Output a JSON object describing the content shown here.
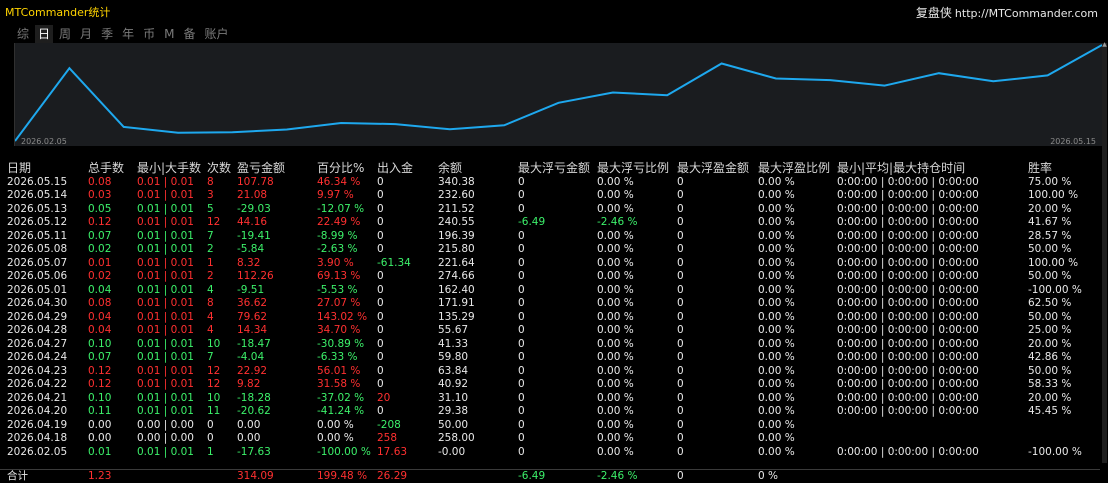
{
  "title": "MTCommander统计",
  "brand": {
    "name": "复盘侠",
    "url": "http://MTCommander.com"
  },
  "tabs": [
    {
      "label": "综",
      "active": false
    },
    {
      "label": "日",
      "active": true
    },
    {
      "label": "周",
      "active": false
    },
    {
      "label": "月",
      "active": false
    },
    {
      "label": "季",
      "active": false
    },
    {
      "label": "年",
      "active": false
    },
    {
      "label": "币",
      "active": false
    },
    {
      "label": "M",
      "active": false
    },
    {
      "label": "备",
      "active": false
    },
    {
      "label": "账户",
      "active": false
    }
  ],
  "colors": {
    "line": "#1ea8ee",
    "loss": "#ff3030",
    "profit": "#3cf06a",
    "chart_bg": "#1a1c1f"
  },
  "chart_data": {
    "type": "line",
    "x_labels": [
      "2026.02.05",
      "2026.05.15"
    ],
    "x": [
      "2026.02.05",
      "2026.04.18",
      "2026.04.19",
      "2026.04.20",
      "2026.04.21",
      "2026.04.22",
      "2026.04.23",
      "2026.04.24",
      "2026.04.27",
      "2026.04.28",
      "2026.04.29",
      "2026.04.30",
      "2026.05.01",
      "2026.05.06",
      "2026.05.07",
      "2026.05.08",
      "2026.05.11",
      "2026.05.12",
      "2026.05.13",
      "2026.05.14",
      "2026.05.15"
    ],
    "y": [
      -0.0,
      258.0,
      50.0,
      29.38,
      31.1,
      40.92,
      63.84,
      59.8,
      41.33,
      55.67,
      135.29,
      171.91,
      162.4,
      274.66,
      221.64,
      215.8,
      196.39,
      240.55,
      211.52,
      232.6,
      340.38
    ],
    "ylim": [
      0,
      340.38
    ],
    "grid": false
  },
  "table": {
    "headers": [
      "日期",
      "总手数",
      "最小|大手数",
      "次数",
      "盈亏金额",
      "百分比%",
      "出入金",
      "余额",
      "最大浮亏金额",
      "最大浮亏比例",
      "最大浮盈金额",
      "最大浮盈比例",
      "最小|平均|最大持仓时间",
      "胜率"
    ],
    "rows": [
      {
        "cells": [
          "2026.05.15",
          "0.08",
          "0.01 | 0.01",
          "8",
          "107.78",
          "46.34 %",
          "0",
          "340.38",
          "0",
          "0.00 %",
          "0",
          "0.00 %",
          "0:00:00 | 0:00:00 | 0:00:00",
          "75.00 %"
        ],
        "pl": "loss",
        "io": "wh",
        "mfe": "wh"
      },
      {
        "cells": [
          "2026.05.14",
          "0.03",
          "0.01 | 0.01",
          "3",
          "21.08",
          "9.97 %",
          "0",
          "232.60",
          "0",
          "0.00 %",
          "0",
          "0.00 %",
          "0:00:00 | 0:00:00 | 0:00:00",
          "100.00 %"
        ],
        "pl": "loss",
        "io": "wh",
        "mfe": "wh"
      },
      {
        "cells": [
          "2026.05.13",
          "0.05",
          "0.01 | 0.01",
          "5",
          "-29.03",
          "-12.07 %",
          "0",
          "211.52",
          "0",
          "0.00 %",
          "0",
          "0.00 %",
          "0:00:00 | 0:00:00 | 0:00:00",
          "20.00 %"
        ],
        "pl": "profit",
        "io": "wh",
        "mfe": "wh"
      },
      {
        "cells": [
          "2026.05.12",
          "0.12",
          "0.01 | 0.01",
          "12",
          "44.16",
          "22.49 %",
          "0",
          "240.55",
          "-6.49",
          "-2.46 %",
          "0",
          "0.00 %",
          "0:00:00 | 0:00:00 | 0:00:00",
          "41.67 %"
        ],
        "pl": "loss",
        "io": "wh",
        "mfe": "profit"
      },
      {
        "cells": [
          "2026.05.11",
          "0.07",
          "0.01 | 0.01",
          "7",
          "-19.41",
          "-8.99 %",
          "0",
          "196.39",
          "0",
          "0.00 %",
          "0",
          "0.00 %",
          "0:00:00 | 0:00:00 | 0:00:00",
          "28.57 %"
        ],
        "pl": "profit",
        "io": "wh",
        "mfe": "wh"
      },
      {
        "cells": [
          "2026.05.08",
          "0.02",
          "0.01 | 0.01",
          "2",
          "-5.84",
          "-2.63 %",
          "0",
          "215.80",
          "0",
          "0.00 %",
          "0",
          "0.00 %",
          "0:00:00 | 0:00:00 | 0:00:00",
          "50.00 %"
        ],
        "pl": "profit",
        "io": "wh",
        "mfe": "wh"
      },
      {
        "cells": [
          "2026.05.07",
          "0.01",
          "0.01 | 0.01",
          "1",
          "8.32",
          "3.90 %",
          "-61.34",
          "221.64",
          "0",
          "0.00 %",
          "0",
          "0.00 %",
          "0:00:00 | 0:00:00 | 0:00:00",
          "100.00 %"
        ],
        "pl": "loss",
        "io": "profit",
        "mfe": "wh"
      },
      {
        "cells": [
          "2026.05.06",
          "0.02",
          "0.01 | 0.01",
          "2",
          "112.26",
          "69.13 %",
          "0",
          "274.66",
          "0",
          "0.00 %",
          "0",
          "0.00 %",
          "0:00:00 | 0:00:00 | 0:00:00",
          "50.00 %"
        ],
        "pl": "loss",
        "io": "wh",
        "mfe": "wh"
      },
      {
        "cells": [
          "2026.05.01",
          "0.04",
          "0.01 | 0.01",
          "4",
          "-9.51",
          "-5.53 %",
          "0",
          "162.40",
          "0",
          "0.00 %",
          "0",
          "0.00 %",
          "0:00:00 | 0:00:00 | 0:00:00",
          "-100.00 %"
        ],
        "pl": "profit",
        "io": "wh",
        "mfe": "wh"
      },
      {
        "cells": [
          "2026.04.30",
          "0.08",
          "0.01 | 0.01",
          "8",
          "36.62",
          "27.07 %",
          "0",
          "171.91",
          "0",
          "0.00 %",
          "0",
          "0.00 %",
          "0:00:00 | 0:00:00 | 0:00:00",
          "62.50 %"
        ],
        "pl": "loss",
        "io": "wh",
        "mfe": "wh"
      },
      {
        "cells": [
          "2026.04.29",
          "0.04",
          "0.01 | 0.01",
          "4",
          "79.62",
          "143.02 %",
          "0",
          "135.29",
          "0",
          "0.00 %",
          "0",
          "0.00 %",
          "0:00:00 | 0:00:00 | 0:00:00",
          "50.00 %"
        ],
        "pl": "loss",
        "io": "wh",
        "mfe": "wh"
      },
      {
        "cells": [
          "2026.04.28",
          "0.04",
          "0.01 | 0.01",
          "4",
          "14.34",
          "34.70 %",
          "0",
          "55.67",
          "0",
          "0.00 %",
          "0",
          "0.00 %",
          "0:00:00 | 0:00:00 | 0:00:00",
          "25.00 %"
        ],
        "pl": "loss",
        "io": "wh",
        "mfe": "wh"
      },
      {
        "cells": [
          "2026.04.27",
          "0.10",
          "0.01 | 0.01",
          "10",
          "-18.47",
          "-30.89 %",
          "0",
          "41.33",
          "0",
          "0.00 %",
          "0",
          "0.00 %",
          "0:00:00 | 0:00:00 | 0:00:00",
          "20.00 %"
        ],
        "pl": "profit",
        "io": "wh",
        "mfe": "wh"
      },
      {
        "cells": [
          "2026.04.24",
          "0.07",
          "0.01 | 0.01",
          "7",
          "-4.04",
          "-6.33 %",
          "0",
          "59.80",
          "0",
          "0.00 %",
          "0",
          "0.00 %",
          "0:00:00 | 0:00:00 | 0:00:00",
          "42.86 %"
        ],
        "pl": "profit",
        "io": "wh",
        "mfe": "wh"
      },
      {
        "cells": [
          "2026.04.23",
          "0.12",
          "0.01 | 0.01",
          "12",
          "22.92",
          "56.01 %",
          "0",
          "63.84",
          "0",
          "0.00 %",
          "0",
          "0.00 %",
          "0:00:00 | 0:00:00 | 0:00:00",
          "50.00 %"
        ],
        "pl": "loss",
        "io": "wh",
        "mfe": "wh"
      },
      {
        "cells": [
          "2026.04.22",
          "0.12",
          "0.01 | 0.01",
          "12",
          "9.82",
          "31.58 %",
          "0",
          "40.92",
          "0",
          "0.00 %",
          "0",
          "0.00 %",
          "0:00:00 | 0:00:00 | 0:00:00",
          "58.33 %"
        ],
        "pl": "loss",
        "io": "wh",
        "mfe": "wh"
      },
      {
        "cells": [
          "2026.04.21",
          "0.10",
          "0.01 | 0.01",
          "10",
          "-18.28",
          "-37.02 %",
          "20",
          "31.10",
          "0",
          "0.00 %",
          "0",
          "0.00 %",
          "0:00:00 | 0:00:00 | 0:00:00",
          "20.00 %"
        ],
        "pl": "profit",
        "io": "loss",
        "mfe": "wh"
      },
      {
        "cells": [
          "2026.04.20",
          "0.11",
          "0.01 | 0.01",
          "11",
          "-20.62",
          "-41.24 %",
          "0",
          "29.38",
          "0",
          "0.00 %",
          "0",
          "0.00 %",
          "0:00:00 | 0:00:00 | 0:00:00",
          "45.45 %"
        ],
        "pl": "profit",
        "io": "wh",
        "mfe": "wh"
      },
      {
        "cells": [
          "2026.04.19",
          "0.00",
          "0.00 | 0.00",
          "0",
          "0.00",
          "0.00 %",
          "-208",
          "50.00",
          "0",
          "0.00 %",
          "0",
          "0.00 %",
          "",
          ""
        ],
        "pl": "wh",
        "io": "profit",
        "mfe": "wh"
      },
      {
        "cells": [
          "2026.04.18",
          "0.00",
          "0.00 | 0.00",
          "0",
          "0.00",
          "0.00 %",
          "258",
          "258.00",
          "0",
          "0.00 %",
          "0",
          "0.00 %",
          "",
          ""
        ],
        "pl": "wh",
        "io": "loss",
        "mfe": "wh"
      },
      {
        "cells": [
          "2026.02.05",
          "0.01",
          "0.01 | 0.01",
          "1",
          "-17.63",
          "-100.00 %",
          "17.63",
          "-0.00",
          "0",
          "0.00 %",
          "0",
          "0.00 %",
          "0:00:00 | 0:00:00 | 0:00:00",
          "-100.00 %"
        ],
        "pl": "profit",
        "io": "loss",
        "mfe": "wh"
      }
    ],
    "total": {
      "cells": [
        "合计",
        "1.23",
        "",
        "",
        "314.09",
        "199.48 %",
        "26.29",
        "",
        "-6.49",
        "-2.46 %",
        "0",
        "0 %",
        "",
        ""
      ]
    }
  }
}
